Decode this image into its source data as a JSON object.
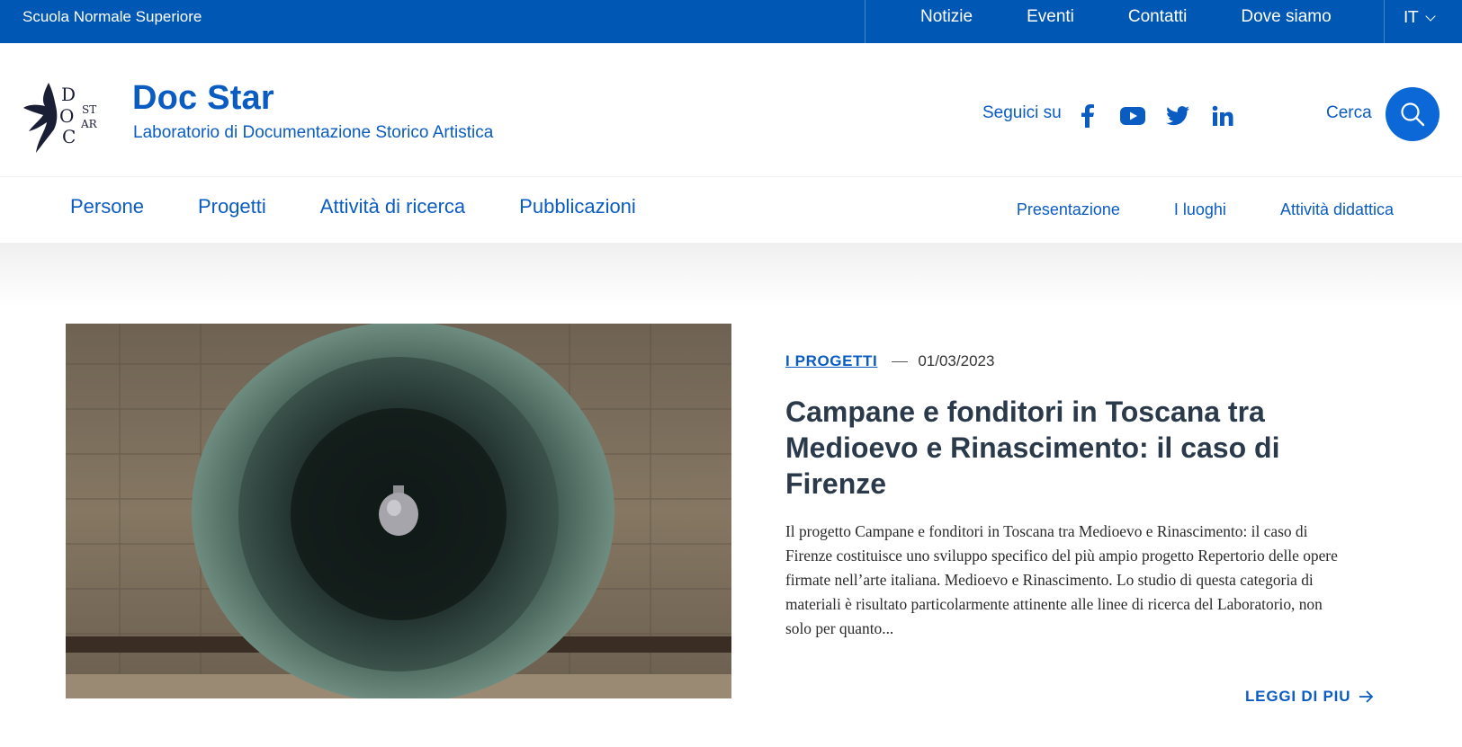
{
  "topbar": {
    "institution": "Scuola Normale Superiore",
    "links": [
      "Notizie",
      "Eventi",
      "Contatti",
      "Dove siamo"
    ],
    "language": "IT"
  },
  "header": {
    "logo_letters": {
      "d": "D",
      "o": "O",
      "c": "C",
      "st": "ST",
      "ar": "AR"
    },
    "title": "Doc Star",
    "subtitle": "Laboratorio di Documentazione Storico Artistica",
    "follow_label": "Seguici su",
    "social_icons": [
      "facebook-icon",
      "youtube-icon",
      "twitter-icon",
      "linkedin-icon"
    ],
    "search_label": "Cerca"
  },
  "nav": {
    "main": [
      "Persone",
      "Progetti",
      "Attività di ricerca",
      "Pubblicazioni"
    ],
    "secondary": [
      "Presentazione",
      "I luoghi",
      "Attività didattica"
    ]
  },
  "article": {
    "category": "I PROGETTI",
    "date": "01/03/2023",
    "title": "Campane e fonditori in Toscana tra Medioevo e Rinascimento: il caso di Firenze",
    "abstract": "Il progetto Campane e fonditori in Toscana tra Medioevo e Rinascimento: il caso di Firenze costituisce uno sviluppo specifico del più ampio progetto Repertorio delle opere firmate nell’arte italiana. Medioevo e Rinascimento. Lo studio di questa categoria di materiali è risultato particolarmente attinente alle linee di ricerca del Laboratorio, non solo per quanto...",
    "read_more": "LEGGI DI PIU"
  },
  "colors": {
    "brand_blue": "#0057b4",
    "link_blue": "#0b5cc2",
    "headline": "#2b3a4a"
  }
}
